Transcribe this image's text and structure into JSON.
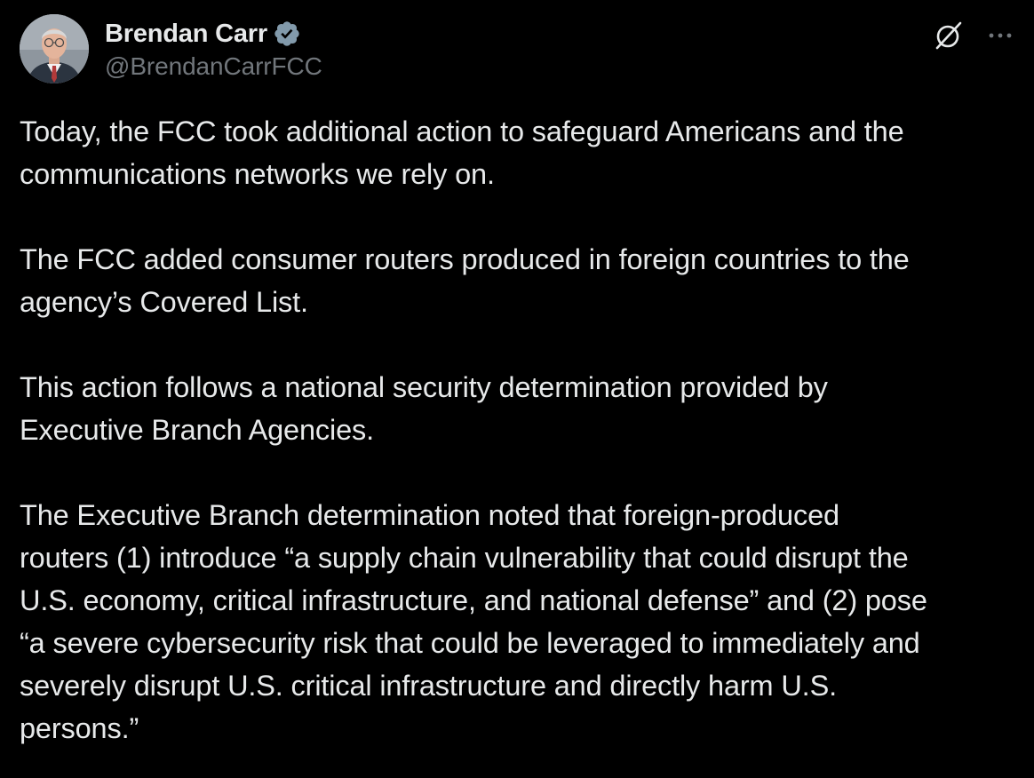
{
  "author": {
    "display_name": "Brendan Carr",
    "handle": "@BrendanCarrFCC",
    "verified": true
  },
  "icons": {
    "avatar": "avatar-photo",
    "verified": "verified-badge-icon",
    "grok": "grok-icon",
    "more": "more-options-icon"
  },
  "colors": {
    "background": "#000000",
    "text": "#e7e9ea",
    "secondary_text": "#71767b",
    "verified_badge": "#829aab"
  },
  "tweet": {
    "paragraphs": [
      "Today, the FCC took additional action to safeguard Americans and the\ncommunications networks we rely on.",
      "The FCC added consumer routers produced in foreign countries to the\nagency’s Covered List.",
      "This action follows a national security determination provided by\nExecutive Branch Agencies.",
      "The Executive Branch determination noted that foreign-produced\nrouters (1) introduce “a supply chain vulnerability that could disrupt the\nU.S. economy, critical infrastructure, and national defense” and (2) pose\n“a severe cybersecurity risk that could be leveraged to immediately and\nseverely disrupt U.S. critical infrastructure and directly harm U.S.\npersons.”"
    ]
  }
}
